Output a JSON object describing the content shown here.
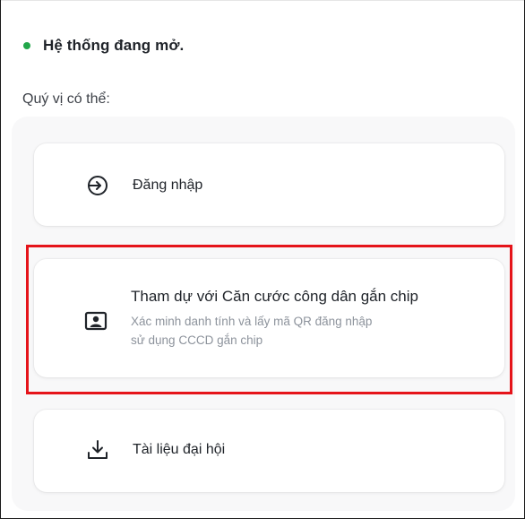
{
  "status": {
    "text": "Hệ thống đang mở.",
    "dot_color": "#22a64a"
  },
  "hint": "Quý vị có thể:",
  "options": {
    "login": {
      "icon": "login-arrow-icon",
      "label": "Đăng nhập"
    },
    "cccd": {
      "icon": "id-card-icon",
      "label": "Tham dự với Căn cước công dân gắn chip",
      "description_line1": "Xác minh danh tính và lấy mã QR đăng nhập",
      "description_line2": "sử dụng CCCD gắn chip"
    },
    "documents": {
      "icon": "download-icon",
      "label": "Tài liệu đại hội"
    }
  },
  "highlight_color": "#e5141a"
}
